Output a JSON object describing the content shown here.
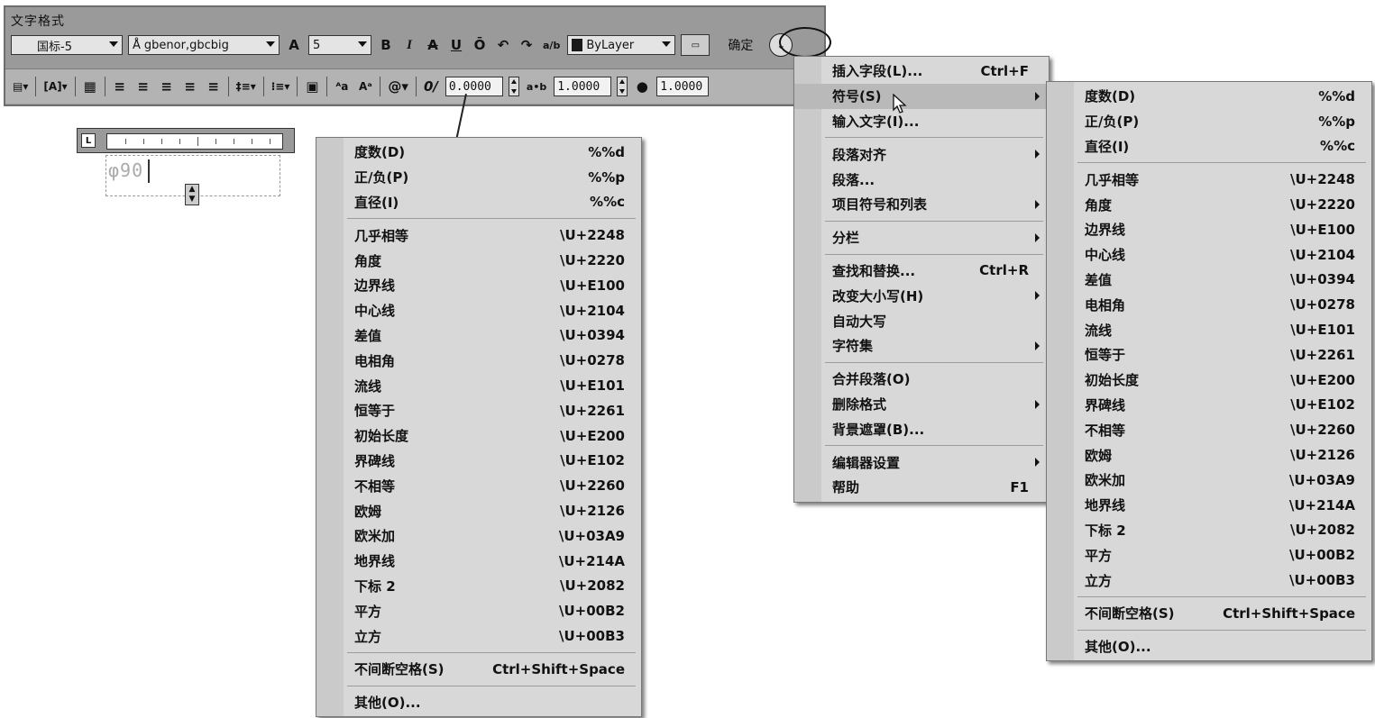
{
  "toolbar": {
    "title": "文字格式",
    "style_combo": "国标-5",
    "font_combo": "gbenor,gbcbig",
    "height_field": "5",
    "bold": "B",
    "italic": "I",
    "strike": "A",
    "underline": "U",
    "overline": "Ō",
    "undo": "↶",
    "redo": "↷",
    "stack": "a/b",
    "color_combo": "ByLayer",
    "ok_label": "确定",
    "oblique_value": "0.0000",
    "tracking_value": "1.0000",
    "width_value": "1.0000",
    "align_labels": [
      "≡",
      "≡",
      "≡",
      "≡",
      "≡"
    ],
    "subscript": "ᴬa",
    "superscript": "Aᵃ"
  },
  "editor": {
    "text": "φ90"
  },
  "symbol_menu_left": {
    "groups": [
      [
        {
          "label": "度数(D)",
          "shortcut": "%%d"
        },
        {
          "label": "正/负(P)",
          "shortcut": "%%p"
        },
        {
          "label": "直径(I)",
          "shortcut": "%%c"
        }
      ],
      [
        {
          "label": "几乎相等",
          "shortcut": "\\U+2248"
        },
        {
          "label": "角度",
          "shortcut": "\\U+2220"
        },
        {
          "label": "边界线",
          "shortcut": "\\U+E100"
        },
        {
          "label": "中心线",
          "shortcut": "\\U+2104"
        },
        {
          "label": "差值",
          "shortcut": "\\U+0394"
        },
        {
          "label": "电相角",
          "shortcut": "\\U+0278"
        },
        {
          "label": "流线",
          "shortcut": "\\U+E101"
        },
        {
          "label": "恒等于",
          "shortcut": "\\U+2261"
        },
        {
          "label": "初始长度",
          "shortcut": "\\U+E200"
        },
        {
          "label": "界碑线",
          "shortcut": "\\U+E102"
        },
        {
          "label": "不相等",
          "shortcut": "\\U+2260"
        },
        {
          "label": "欧姆",
          "shortcut": "\\U+2126"
        },
        {
          "label": "欧米加",
          "shortcut": "\\U+03A9"
        },
        {
          "label": "地界线",
          "shortcut": "\\U+214A"
        },
        {
          "label": "下标 2",
          "shortcut": "\\U+2082"
        },
        {
          "label": "平方",
          "shortcut": "\\U+00B2"
        },
        {
          "label": "立方",
          "shortcut": "\\U+00B3"
        }
      ],
      [
        {
          "label": "不间断空格(S)",
          "shortcut": "Ctrl+Shift+Space"
        }
      ],
      [
        {
          "label": "其他(O)...",
          "shortcut": ""
        }
      ]
    ]
  },
  "options_menu": {
    "groups": [
      [
        {
          "label": "插入字段(L)...",
          "shortcut": "Ctrl+F",
          "submenu": false
        },
        {
          "label": "符号(S)",
          "shortcut": "",
          "submenu": true,
          "highlighted": true
        },
        {
          "label": "输入文字(I)...",
          "shortcut": "",
          "submenu": false
        }
      ],
      [
        {
          "label": "段落对齐",
          "shortcut": "",
          "submenu": true
        },
        {
          "label": "段落...",
          "shortcut": "",
          "submenu": false
        },
        {
          "label": "项目符号和列表",
          "shortcut": "",
          "submenu": true
        }
      ],
      [
        {
          "label": "分栏",
          "shortcut": "",
          "submenu": true
        }
      ],
      [
        {
          "label": "查找和替换...",
          "shortcut": "Ctrl+R",
          "submenu": false
        },
        {
          "label": "改变大小写(H)",
          "shortcut": "",
          "submenu": true
        },
        {
          "label": "自动大写",
          "shortcut": "",
          "submenu": false
        },
        {
          "label": "字符集",
          "shortcut": "",
          "submenu": true
        }
      ],
      [
        {
          "label": "合并段落(O)",
          "shortcut": "",
          "submenu": false
        },
        {
          "label": "删除格式",
          "shortcut": "",
          "submenu": true
        },
        {
          "label": "背景遮罩(B)...",
          "shortcut": "",
          "submenu": false
        }
      ],
      [
        {
          "label": "编辑器设置",
          "shortcut": "",
          "submenu": true
        },
        {
          "label": "帮助",
          "shortcut": "F1",
          "submenu": false
        }
      ]
    ]
  },
  "colors": {
    "toolbar_bg": "#9a9a9a",
    "menu_bg": "#d8d8d8",
    "highlight": "#b9b9b9"
  }
}
